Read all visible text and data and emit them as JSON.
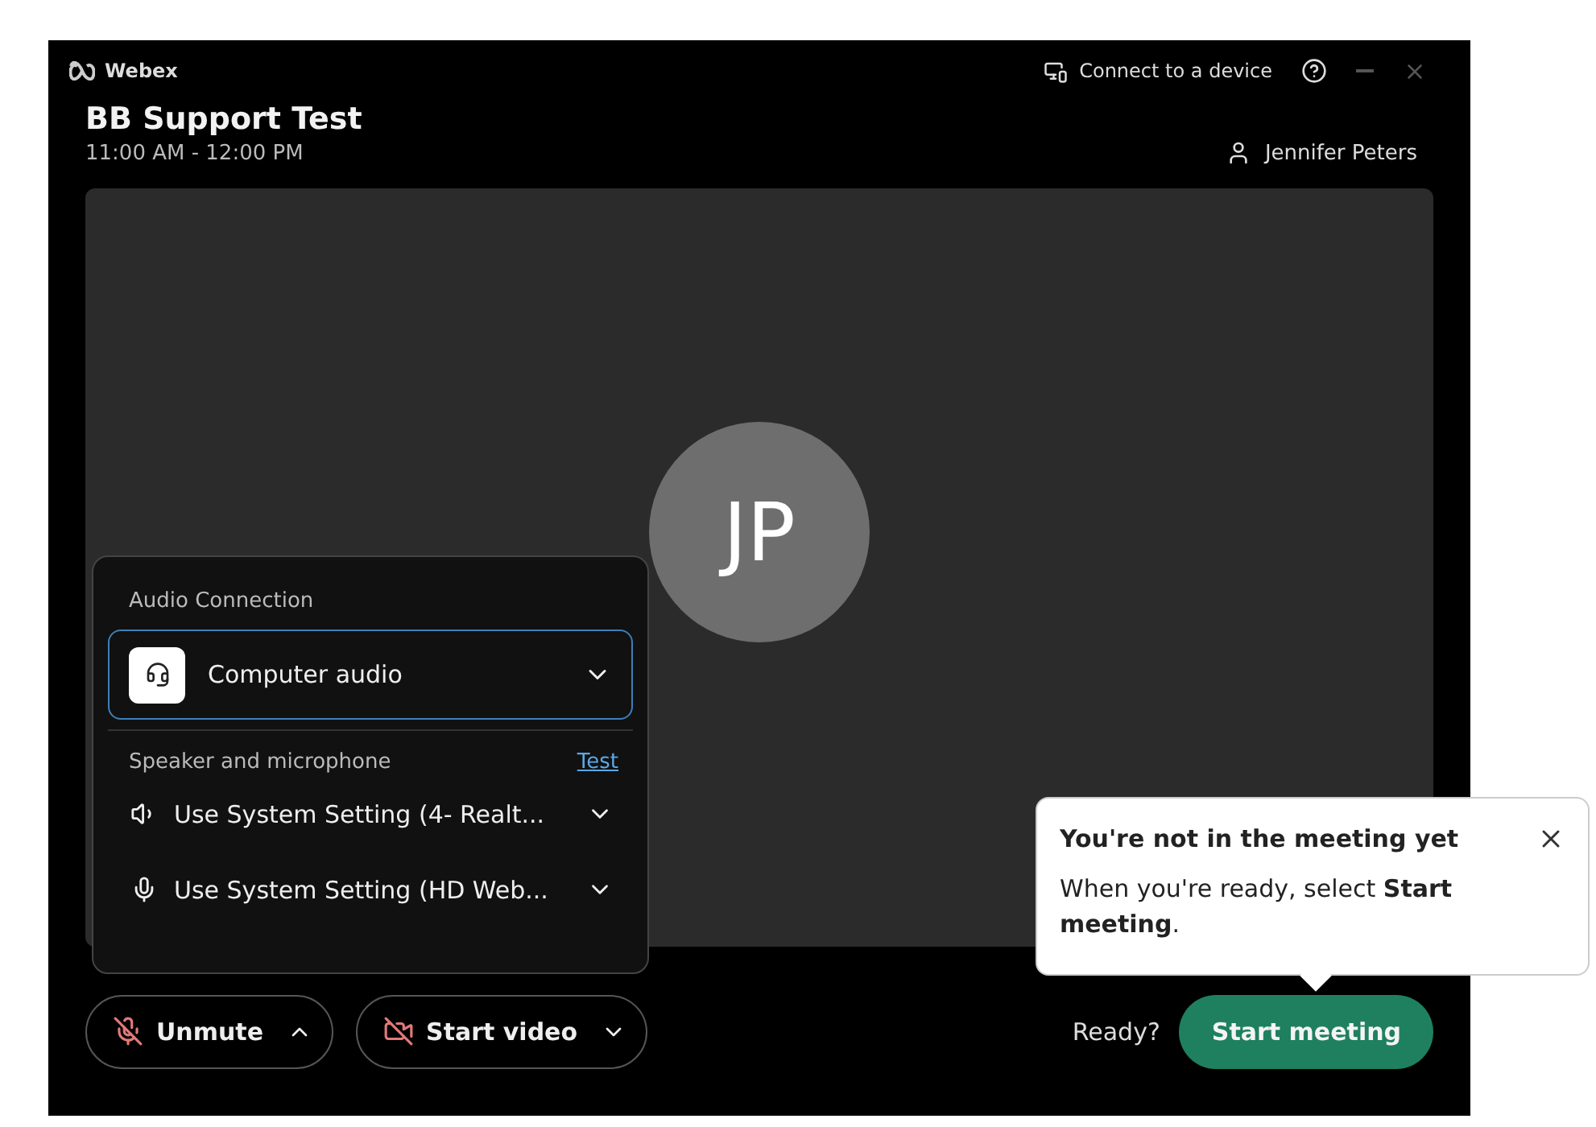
{
  "window": {
    "app_name": "Webex",
    "connect_label": "Connect to a device"
  },
  "meeting": {
    "title": "BB Support Test",
    "time": "11:00 AM - 12:00 PM",
    "host": "Jennifer Peters"
  },
  "avatar": {
    "initials": "JP"
  },
  "audio_panel": {
    "heading": "Audio Connection",
    "selected_option": "Computer audio",
    "devices_heading": "Speaker and microphone",
    "test_link": "Test",
    "devices": [
      {
        "kind": "speaker",
        "label": "Use System Setting (4- Realt..."
      },
      {
        "kind": "microphone",
        "label": "Use System Setting (HD Web..."
      }
    ]
  },
  "controls": [
    {
      "kind": "audio",
      "label": "Unmute",
      "on": false,
      "expanded": true
    },
    {
      "kind": "video",
      "label": "Start video",
      "on": false,
      "expanded": false
    }
  ],
  "ready_label": "Ready?",
  "start_button": "Start meeting",
  "tooltip": {
    "title": "You're not in the meeting yet",
    "body": "When you're ready, select **Start meeting**."
  }
}
